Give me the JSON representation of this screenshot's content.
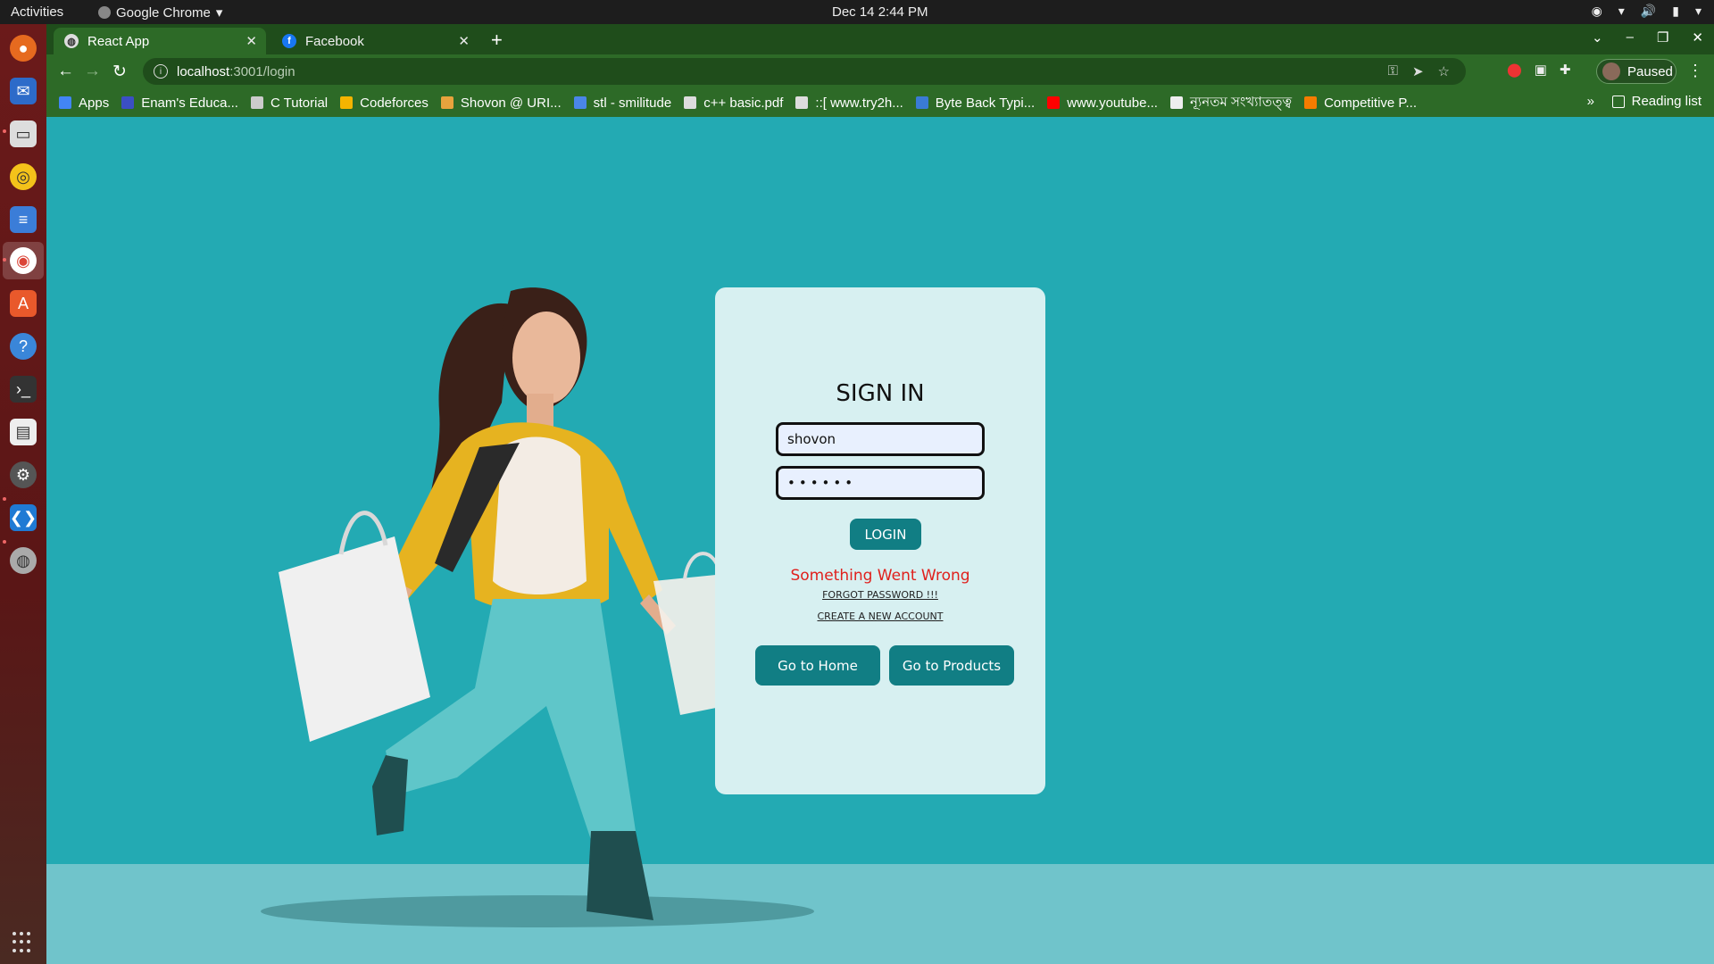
{
  "system_bar": {
    "activities": "Activities",
    "app_name": "Google Chrome",
    "clock": "Dec 14  2:44 PM"
  },
  "browser": {
    "tabs": [
      {
        "label": "React App",
        "active": true
      },
      {
        "label": "Facebook",
        "active": false
      }
    ],
    "url_host": "localhost",
    "url_path": ":3001/login",
    "profile_label": "Paused",
    "bookmarks": [
      {
        "label": "Apps",
        "color": "#4285f4"
      },
      {
        "label": "Enam's Educa...",
        "color": "#3b4fc4"
      },
      {
        "label": "C Tutorial",
        "color": "#cccccc"
      },
      {
        "label": "Codeforces",
        "color": "#f4b400"
      },
      {
        "label": "Shovon @ URI...",
        "color": "#e8a33d"
      },
      {
        "label": "stl - smilitude",
        "color": "#4a86e8"
      },
      {
        "label": "c++ basic.pdf",
        "color": "#dddddd"
      },
      {
        "label": "::[ www.try2h...",
        "color": "#dddddd"
      },
      {
        "label": "Byte Back Typi...",
        "color": "#3a7bd5"
      },
      {
        "label": "www.youtube...",
        "color": "#ff0000"
      },
      {
        "label": "ন্যূনতম সংখ্যাতত্ত্ব",
        "color": "#eeeeee"
      },
      {
        "label": "Competitive P...",
        "color": "#f57c00"
      }
    ],
    "reading_list": "Reading list"
  },
  "login": {
    "title": "SIGN IN",
    "username_value": "shovon",
    "password_value": "••••••",
    "login_label": "LOGIN",
    "error_message": "Something Went Wrong",
    "forgot_label": "FORGOT PASSWORD !!!",
    "create_label": "CREATE A NEW ACCOUNT",
    "home_label": "Go to Home",
    "products_label": "Go to Products"
  },
  "colors": {
    "page_bg": "#23aab3",
    "card_bg": "#d7f0f1",
    "accent": "#117e84",
    "error": "#e0201c",
    "chrome_green": "#2d6a27"
  }
}
